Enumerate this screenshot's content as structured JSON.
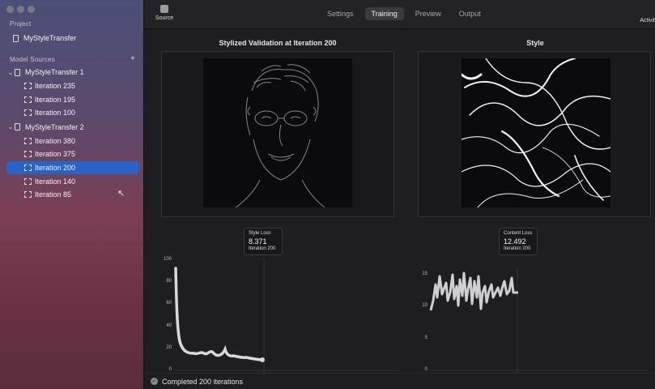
{
  "sidebar": {
    "project_label": "Project",
    "project_name": "MyStyleTransfer",
    "sources_label": "Model Sources",
    "add_label": "+",
    "models": [
      {
        "name": "MyStyleTransfer 1",
        "iterations": [
          "Iteration 235",
          "Iteration 195",
          "Iteration 100"
        ]
      },
      {
        "name": "MyStyleTransfer 2",
        "iterations": [
          "Iteration 380",
          "Iteration 375",
          "Iteration 200",
          "Iteration 140",
          "Iteration 85"
        ]
      }
    ],
    "selected": "Iteration 200"
  },
  "toolbar": {
    "source_label": "Source",
    "activity_label": "Activit",
    "tabs": [
      "Settings",
      "Training",
      "Preview",
      "Output"
    ],
    "active_tab": "Training"
  },
  "panels": {
    "validation_title": "Stylized Validation at Iteration 200",
    "style_title": "Style"
  },
  "style_loss": {
    "label": "Style Loss",
    "value": "8.371",
    "iteration": "Iteration 200",
    "yticks": [
      "100",
      "80",
      "60",
      "40",
      "20",
      "0"
    ]
  },
  "content_loss": {
    "label": "Content Loss",
    "value": "12.492",
    "iteration": "Iteration 200",
    "yticks": [
      "15",
      "10",
      "5",
      "0"
    ]
  },
  "status": {
    "text": "Completed 200 iterations"
  },
  "colors": {
    "selection": "#2a63c6",
    "curve": "#d9d9dc"
  }
}
